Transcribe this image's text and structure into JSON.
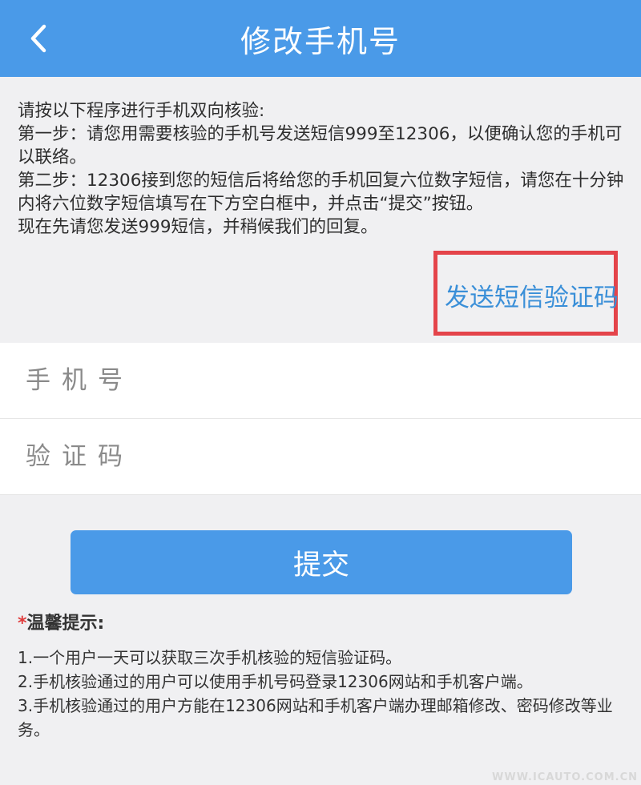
{
  "header": {
    "title": "修改手机号",
    "back_icon": "chevron-left-icon"
  },
  "instructions": [
    "请按以下程序进行手机双向核验:",
    "第一步：请您用需要核验的手机号发送短信999至12306，以便确认您的手机可以联络。",
    "第二步：12306接到您的短信后将给您的手机回复六位数字短信，请您在十分钟内将六位数字短信填写在下方空白框中，并点击“提交”按钮。",
    "现在先请您发送999短信，并稍候我们的回复。"
  ],
  "send_code": {
    "label": "发送短信验证码"
  },
  "form": {
    "phone_placeholder": "手机号",
    "code_placeholder": "验证码",
    "phone_value": "",
    "code_value": ""
  },
  "submit": {
    "label": "提交"
  },
  "tips": {
    "star": "*",
    "title": "温馨提示:",
    "items": [
      "1.一个用户一天可以获取三次手机核验的短信验证码。",
      "2.手机核验通过的用户可以使用手机号码登录12306网站和手机客户端。",
      "3.手机核验通过的用户方能在12306网站和手机客户端办理邮箱修改、密码修改等业务。"
    ]
  },
  "watermark": "WWW.ICAUTO.COM.CN",
  "colors": {
    "header": "#4a9ae8",
    "link": "#3a8fd8",
    "highlight_border": "#e4444a",
    "submit": "#4a9ae8"
  }
}
